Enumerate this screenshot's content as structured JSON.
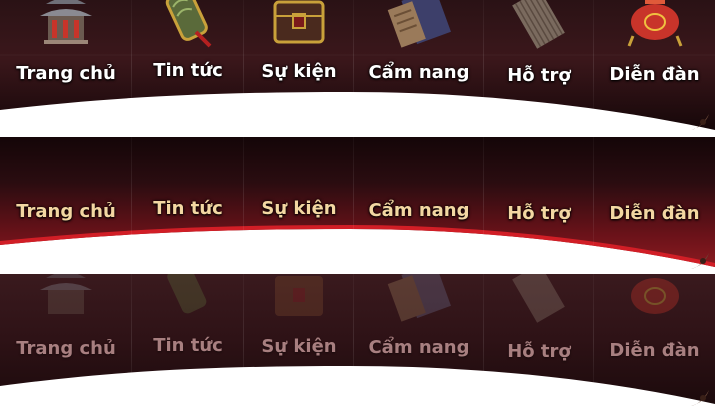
{
  "colors": {
    "bar_dark": "#1a0a0c",
    "bar_mid": "#3a1418",
    "bar_red": "#7a1a20",
    "accent_red": "#d11e26",
    "label_gold": "#f3d7a2",
    "label_white": "#ffffff",
    "label_dim": "#a87f80"
  },
  "menus": [
    {
      "state": "normal",
      "items": [
        {
          "label": "Trang chủ",
          "icon": "palace-icon"
        },
        {
          "label": "Tin tức",
          "icon": "scroll-icon"
        },
        {
          "label": "Sự kiện",
          "icon": "treasure-chest-icon"
        },
        {
          "label": "Cẩm nang",
          "icon": "book-icon"
        },
        {
          "label": "Hỗ trợ",
          "icon": "bamboo-scroll-icon"
        },
        {
          "label": "Diễn đàn",
          "icon": "incense-burner-icon"
        }
      ]
    },
    {
      "state": "hover",
      "items": [
        {
          "label": "Trang chủ"
        },
        {
          "label": "Tin tức"
        },
        {
          "label": "Sự kiện"
        },
        {
          "label": "Cẩm nang"
        },
        {
          "label": "Hỗ trợ"
        },
        {
          "label": "Diễn đàn"
        }
      ]
    },
    {
      "state": "faded",
      "items": [
        {
          "label": "Trang chủ",
          "icon": "palace-icon"
        },
        {
          "label": "Tin tức",
          "icon": "scroll-icon"
        },
        {
          "label": "Sự kiện",
          "icon": "treasure-chest-icon"
        },
        {
          "label": "Cẩm nang",
          "icon": "book-icon"
        },
        {
          "label": "Hỗ trợ",
          "icon": "bamboo-scroll-icon"
        },
        {
          "label": "Diễn đàn",
          "icon": "incense-burner-icon"
        }
      ]
    }
  ]
}
